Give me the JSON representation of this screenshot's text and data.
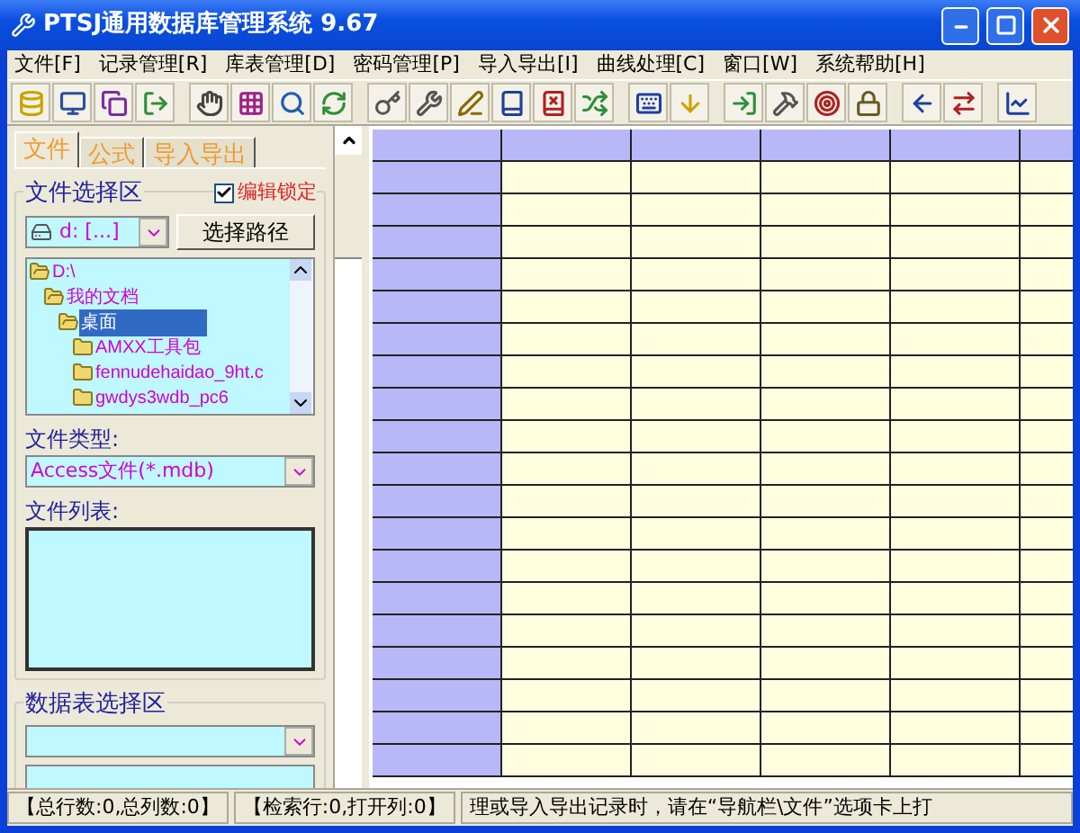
{
  "window": {
    "title": "PTSJ通用数据库管理系统 9.67"
  },
  "menu": [
    "文件[F]",
    "记录管理[R]",
    "库表管理[D]",
    "密码管理[P]",
    "导入导出[I]",
    "曲线处理[C]",
    "窗口[W]",
    "系统帮助[H]"
  ],
  "tabs": [
    {
      "label": "文件",
      "selected": true
    },
    {
      "label": "公式",
      "selected": false
    },
    {
      "label": "导入导出",
      "selected": false
    }
  ],
  "file_area": {
    "title": "文件选择区",
    "edit_lock": {
      "label": "编辑锁定",
      "checked": true
    },
    "drive": "d: [...]",
    "choose_path_button": "选择路径",
    "tree": [
      {
        "label": "D:\\",
        "selected": false,
        "children": [
          {
            "label": "我的文档",
            "selected": false,
            "children": [
              {
                "label": "桌面",
                "selected": true,
                "children": [
                  {
                    "label": "AMXX工具包",
                    "selected": false
                  },
                  {
                    "label": "fennudehaidao_9ht.c",
                    "selected": false
                  },
                  {
                    "label": "gwdys3wdb_pc6",
                    "selected": false
                  }
                ]
              }
            ]
          }
        ]
      }
    ],
    "file_type_label": "文件类型:",
    "file_type": "Access文件(*.mdb)",
    "file_list_label": "文件列表:"
  },
  "table_area": {
    "title": "数据表选择区"
  },
  "status_bar": [
    "【总行数:0,总列数:0】",
    "【检索行:0,打开列:0】",
    "理或导入导出记录时，请在“导航栏\\文件”选项卡上打"
  ]
}
